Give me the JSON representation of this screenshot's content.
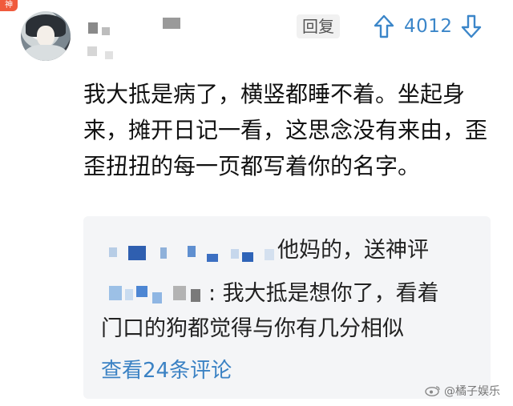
{
  "badge": {
    "label": "神"
  },
  "comment": {
    "reply_label": "回复",
    "vote_count": "4012",
    "text": "我大抵是病了，横竖都睡不着。坐起身来，摊开日记一看，这思念没有来由，歪歪扭扭的每一页都写着你的名字。"
  },
  "replies": [
    {
      "text": "他妈的，送神评"
    },
    {
      "text": ": 我大抵是想你了，看着"
    },
    {
      "text": "门口的狗都觉得与你有几分相似"
    }
  ],
  "view_more_label": "查看24条评论",
  "watermark": {
    "text": "@橘子娱乐"
  },
  "colors": {
    "accent": "#3b82c4",
    "badge": "#f05a3c",
    "card_bg": "#f4f5f7"
  },
  "icons": [
    "upvote-arrow-icon",
    "downvote-arrow-icon",
    "weibo-logo-icon"
  ]
}
